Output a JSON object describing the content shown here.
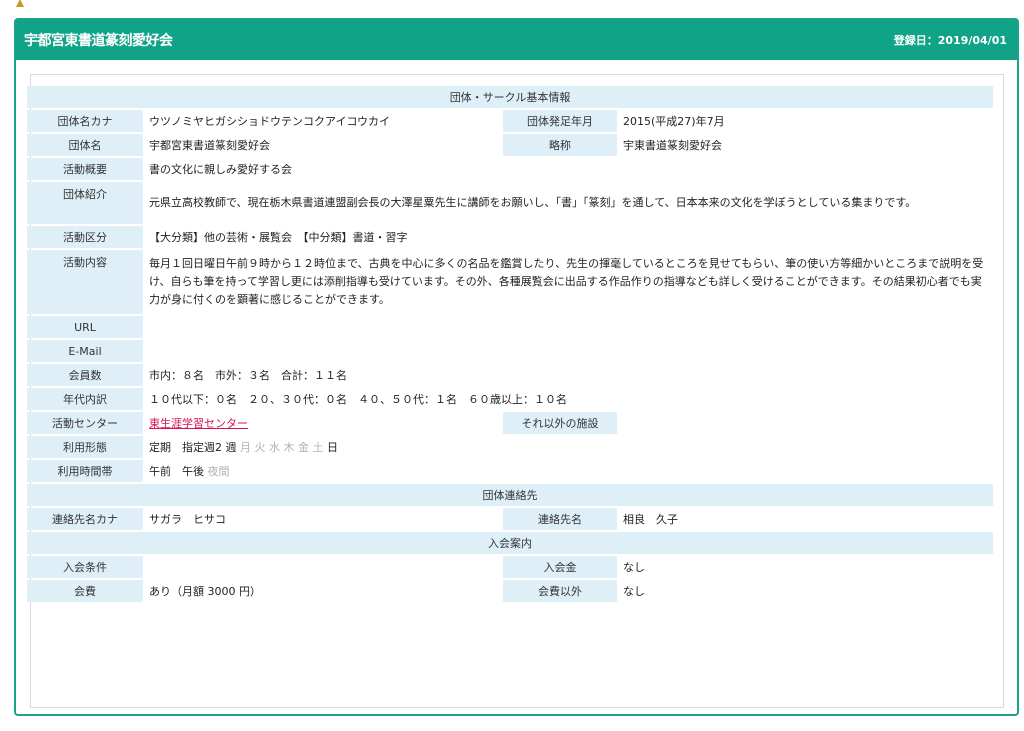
{
  "header": {
    "title": "宇都宮東書道篆刻愛好会",
    "registered": "登録日：2019/04/01"
  },
  "sections": {
    "basic": "団体・サークル基本情報",
    "contact": "団体連絡先",
    "join": "入会案内"
  },
  "basic": {
    "kana_label": "団体名カナ",
    "kana_value": "ウツノミヤヒガシショドウテンコクアイコウカイ",
    "founded_label": "団体発足年月",
    "founded_value": "2015(平成27)年7月",
    "name_label": "団体名",
    "name_value": "宇都宮東書道篆刻愛好会",
    "short_label": "略称",
    "short_value": "宇東書道篆刻愛好会",
    "summary_label": "活動概要",
    "summary_value": "書の文化に親しみ愛好する会",
    "intro_label": "団体紹介",
    "intro_value": "元県立高校教師で、現在栃木県書道連盟副会長の大澤星粟先生に講師をお願いし、「書」「篆刻」を通して、日本本来の文化を学ぼうとしている集まりです。",
    "category_label": "活動区分",
    "category_value": "【大分類】他の芸術・展覧会　【中分類】書道・習字",
    "content_label": "活動内容",
    "content_value": "毎月１回日曜日午前９時から１２時位まで、古典を中心に多くの名品を鑑賞したり、先生の揮毫しているところを見せてもらい、筆の使い方等細かいところまで説明を受け、自らも筆を持って学習し更には添削指導も受けています。その外、各種展覧会に出品する作品作りの指導なども詳しく受けることができます。その結果初心者でも実力が身に付くのを顕著に感じることができます。",
    "url_label": "URL",
    "url_value": "",
    "email_label": "E-Mail",
    "email_value": "",
    "members_label": "会員数",
    "members_value": "市内：８名　市外：３名　合計：１１名",
    "ages_label": "年代内訳",
    "ages_value": "１０代以下：０名　２０、３０代：０名　４０、５０代：１名　６０歳以上：１０名",
    "center_label": "活動センター",
    "center_value": "東生涯学習センター",
    "other_label": "それ以外の施設",
    "other_value": "",
    "usage_label": "利用形態",
    "usage_prefix": "定期　指定週2 週",
    "usage_days_dim": "月 火 水 木 金 土",
    "usage_days_on": "日",
    "time_label": "利用時間帯",
    "time_on": "午前　午後",
    "time_dim": "夜間"
  },
  "contact": {
    "kana_label": "連絡先名カナ",
    "kana_value": "サガラ　ヒサコ",
    "name_label": "連絡先名",
    "name_value": "相良　久子"
  },
  "join": {
    "cond_label": "入会条件",
    "cond_value": "",
    "fee_label": "入会金",
    "fee_value": "なし",
    "dues_label": "会費",
    "dues_value": "あり（月額 3000 円）",
    "other_label": "会費以外",
    "other_value": "なし"
  },
  "colors": {
    "header_bg": "#11a387",
    "label_bg": "#dfeff8",
    "link": "#d4145a"
  }
}
